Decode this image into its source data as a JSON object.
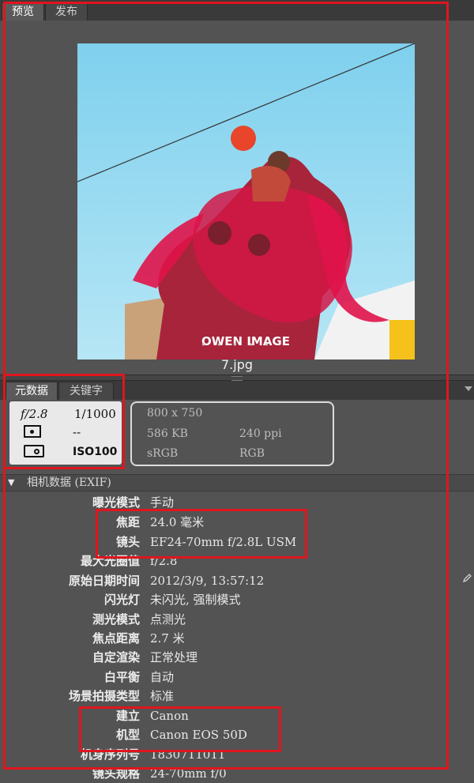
{
  "tabs_top": [
    {
      "label": "预览",
      "active": true
    },
    {
      "label": "发布",
      "active": false
    }
  ],
  "preview": {
    "image_description": "Photo of people splashed with red liquid under a wire",
    "watermark": "OWEN IMAGE",
    "filmstrip_dots": "• • • • •",
    "filename": "7.jpg"
  },
  "tabs_meta": [
    {
      "label": "元数据",
      "active": true
    },
    {
      "label": "关键字",
      "active": false
    }
  ],
  "quick_exif": {
    "aperture": "f/2.8",
    "shutter": "1/1000",
    "metering": "--",
    "iso": "ISO100"
  },
  "file_info": {
    "dimensions": "800 x 750",
    "size": "586 KB",
    "resolution": "240 ppi",
    "color_profile": "sRGB",
    "color_mode": "RGB"
  },
  "section": {
    "toggle": "▼",
    "title": "相机数据 (EXIF)"
  },
  "exif_rows": [
    {
      "key": "曝光模式",
      "value": "手动"
    },
    {
      "key": "焦距",
      "value": "24.0 毫米"
    },
    {
      "key": "镜头",
      "value": "EF24-70mm f/2.8L USM"
    },
    {
      "key": "最大光圈值",
      "value": "f/2.8"
    },
    {
      "key": "原始日期时间",
      "value": "2012/3/9, 13:57:12"
    },
    {
      "key": "闪光灯",
      "value": "未闪光, 强制模式"
    },
    {
      "key": "测光模式",
      "value": "点测光"
    },
    {
      "key": "焦点距离",
      "value": "2.7 米"
    },
    {
      "key": "自定渲染",
      "value": "正常处理"
    },
    {
      "key": "白平衡",
      "value": "自动"
    },
    {
      "key": "场景拍摄类型",
      "value": "标准"
    },
    {
      "key": "建立",
      "value": "Canon"
    },
    {
      "key": "机型",
      "value": "Canon EOS 50D"
    },
    {
      "key": "机身序列号",
      "value": "1830711011"
    },
    {
      "key": "镜头规格",
      "value": "24-70mm f/0"
    }
  ],
  "colors": {
    "panel_bg": "#535353",
    "highlight_red": "#e0151d",
    "sky": "#8fd6ef",
    "red_liquid": "#e0134a"
  }
}
